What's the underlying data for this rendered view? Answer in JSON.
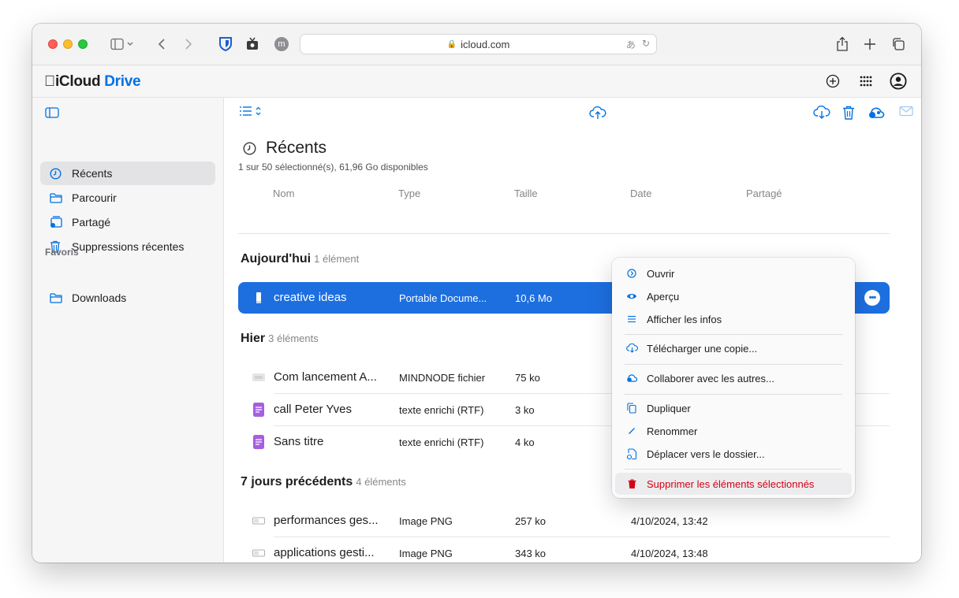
{
  "browser": {
    "url": "icloud.com"
  },
  "app": {
    "brand_icloud": "iCloud",
    "brand_drive": "Drive"
  },
  "sidebar": {
    "items": [
      {
        "label": "Récents",
        "icon": "clock-icon"
      },
      {
        "label": "Parcourir",
        "icon": "folder-icon"
      },
      {
        "label": "Partagé",
        "icon": "shared-folder-icon"
      },
      {
        "label": "Suppressions récentes",
        "icon": "trash-icon"
      }
    ],
    "favorites_title": "Favoris",
    "favorites": [
      {
        "label": "Downloads",
        "icon": "folder-icon"
      }
    ]
  },
  "main": {
    "title": "Récents",
    "subtitle": "1 sur 50 sélectionné(s), 61,96 Go disponibles",
    "columns": [
      "Nom",
      "Type",
      "Taille",
      "Date",
      "Partagé"
    ],
    "groups": [
      {
        "title": "Aujourd'hui",
        "count": "1 élément",
        "rows": [
          {
            "name": "creative ideas",
            "type": "Portable Docume...",
            "size": "10,6 Mo",
            "date": "",
            "icon": "pdf-file-icon"
          }
        ]
      },
      {
        "title": "Hier",
        "count": "3 éléments",
        "rows": [
          {
            "name": "Com lancement A...",
            "type": "MINDNODE fichier",
            "size": "75 ko",
            "date": "",
            "icon": "mindnode-file-icon"
          },
          {
            "name": "call Peter Yves",
            "type": "texte enrichi (RTF)",
            "size": "3 ko",
            "date": "",
            "icon": "rtf-file-icon"
          },
          {
            "name": "Sans titre",
            "type": "texte enrichi (RTF)",
            "size": "4 ko",
            "date": "",
            "icon": "rtf-file-icon"
          }
        ]
      },
      {
        "title": "7 jours précédents",
        "count": "4 éléments",
        "rows": [
          {
            "name": "performances ges...",
            "type": "Image PNG",
            "size": "257 ko",
            "date": "4/10/2024, 13:42",
            "icon": "image-file-icon"
          },
          {
            "name": "applications gesti...",
            "type": "Image PNG",
            "size": "343 ko",
            "date": "4/10/2024, 13:48",
            "icon": "image-file-icon"
          }
        ]
      }
    ]
  },
  "context_menu": {
    "items": [
      {
        "label": "Ouvrir",
        "icon": "open-icon"
      },
      {
        "label": "Aperçu",
        "icon": "eye-icon"
      },
      {
        "label": "Afficher les infos",
        "icon": "info-list-icon"
      },
      {
        "label": "Télécharger une copie...",
        "icon": "cloud-download-icon"
      },
      {
        "label": "Collaborer avec les autres...",
        "icon": "collaborate-icon"
      },
      {
        "label": "Dupliquer",
        "icon": "duplicate-icon"
      },
      {
        "label": "Renommer",
        "icon": "pencil-icon"
      },
      {
        "label": "Déplacer vers le dossier...",
        "icon": "move-folder-icon"
      },
      {
        "label": "Supprimer les éléments sélectionnés",
        "icon": "trash-icon"
      }
    ]
  },
  "colors": {
    "accent": "#0071e3",
    "selection": "#1d6fe0",
    "danger": "#d70015"
  }
}
